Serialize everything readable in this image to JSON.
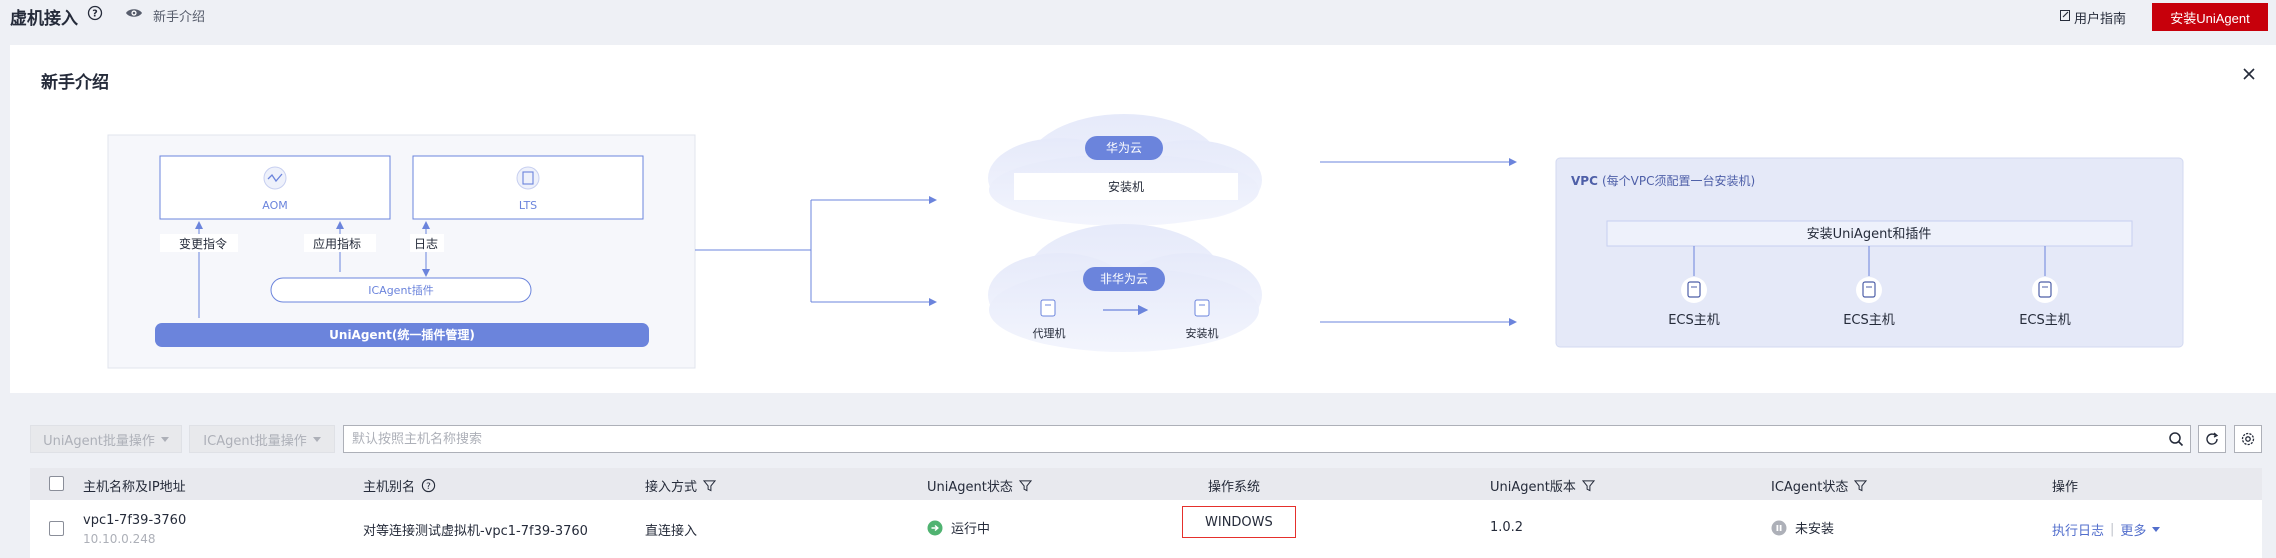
{
  "header": {
    "title": "虚机接入",
    "intro_link": "新手介绍",
    "guide_link": "用户指南",
    "install_button": "安装UniAgent"
  },
  "intro": {
    "title": "新手介绍",
    "left_box": {
      "aom": "AOM",
      "lts": "LTS",
      "change_cmd": "变更指令",
      "app_metrics": "应用指标",
      "logs": "日志",
      "icagent_plugin": "ICAgent插件",
      "uniagent": "UniAgent(统一插件管理)"
    },
    "huawei_cloud": {
      "tag": "华为云",
      "install_machine": "安装机"
    },
    "non_huawei_cloud": {
      "tag": "非华为云",
      "proxy": "代理机",
      "install_machine": "安装机"
    },
    "vpc": {
      "label": "VPC",
      "note": "(每个VPC须配置一台安装机)",
      "install_bar": "安装UniAgent和插件",
      "ecs": [
        "ECS主机",
        "ECS主机",
        "ECS主机"
      ]
    }
  },
  "toolbar": {
    "uniagent_batch": "UniAgent批量操作",
    "icagent_batch": "ICAgent批量操作",
    "search_placeholder": "默认按照主机名称搜索"
  },
  "table": {
    "headers": {
      "host": "主机名称及IP地址",
      "alias": "主机别名",
      "access": "接入方式",
      "uniagent_status": "UniAgent状态",
      "os": "操作系统",
      "uniagent_version": "UniAgent版本",
      "icagent_status": "ICAgent状态",
      "actions": "操作"
    },
    "rows": [
      {
        "host": "vpc1-7f39-3760",
        "ip": "10.10.0.248",
        "alias": "对等连接测试虚拟机-vpc1-7f39-3760",
        "access": "直连接入",
        "uniagent_status": "运行中",
        "os": "WINDOWS",
        "uniagent_version": "1.0.2",
        "icagent_status": "未安装",
        "action_log": "执行日志",
        "action_more": "更多"
      }
    ]
  },
  "colors": {
    "brand_red": "#c7000b",
    "accent_blue": "#6b84dc",
    "link_blue": "#526ecc",
    "running_green": "#50b371",
    "highlight_red": "#e5302c"
  }
}
